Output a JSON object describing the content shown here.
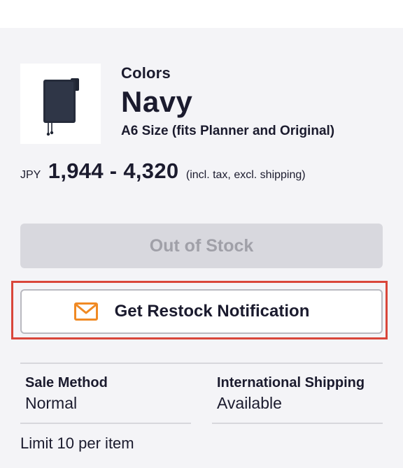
{
  "product": {
    "image_alt": "Navy A6 planner cover",
    "colors_label": "Colors",
    "color_name": "Navy",
    "size_label": "A6 Size (fits Planner and Original)"
  },
  "price": {
    "currency": "JPY",
    "range": "1,944 - 4,320",
    "note": "(incl. tax, excl. shipping)"
  },
  "buttons": {
    "out_of_stock_label": "Out of Stock",
    "restock_label": "Get Restock Notification",
    "restock_icon": "mail-icon"
  },
  "info": {
    "sale_method_label": "Sale Method",
    "sale_method_value": "Normal",
    "shipping_label": "International Shipping",
    "shipping_value": "Available",
    "limit_text": "Limit 10 per item"
  },
  "colors": {
    "accent_orange": "#f08a24",
    "highlight_red": "#d9463a",
    "text_dark": "#1b1b2e",
    "disabled_bg": "#d8d8de",
    "disabled_text": "#a0a0a8"
  }
}
